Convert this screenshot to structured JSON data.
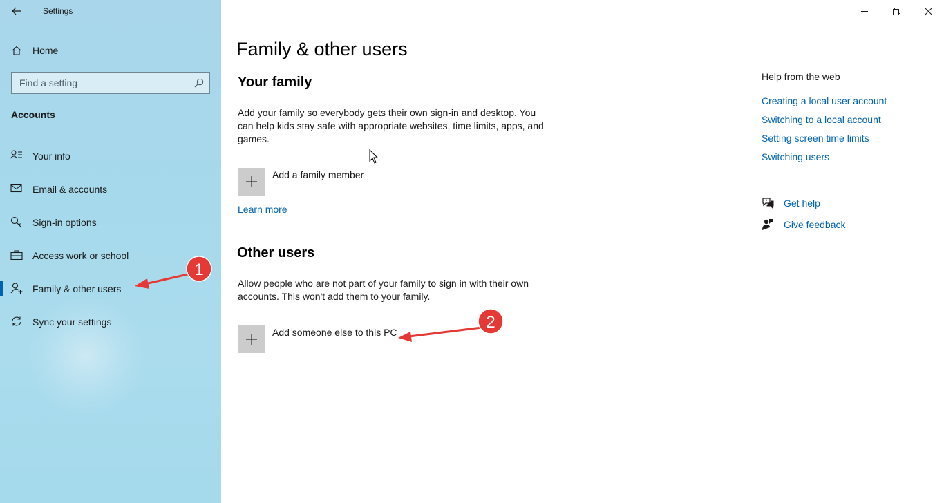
{
  "window": {
    "title": "Settings",
    "controls": [
      "minimize",
      "restore",
      "close"
    ]
  },
  "sidebar": {
    "home_label": "Home",
    "search_placeholder": "Find a setting",
    "section_label": "Accounts",
    "items": [
      {
        "label": "Your info",
        "icon": "person-list-icon",
        "active": false
      },
      {
        "label": "Email & accounts",
        "icon": "mail-icon",
        "active": false
      },
      {
        "label": "Sign-in options",
        "icon": "key-icon",
        "active": false
      },
      {
        "label": "Access work or school",
        "icon": "briefcase-icon",
        "active": false
      },
      {
        "label": "Family & other users",
        "icon": "person-add-icon",
        "active": true
      },
      {
        "label": "Sync your settings",
        "icon": "sync-icon",
        "active": false
      }
    ]
  },
  "main": {
    "title": "Family & other users",
    "family": {
      "heading": "Your family",
      "description": "Add your family so everybody gets their own sign-in and desktop. You can help kids stay safe with appropriate websites, time limits, apps, and games.",
      "add_label": "Add a family member",
      "learn_more": "Learn more"
    },
    "other_users": {
      "heading": "Other users",
      "description": "Allow people who are not part of your family to sign in with their own accounts. This won't add them to your family.",
      "add_label": "Add someone else to this PC"
    }
  },
  "help": {
    "heading": "Help from the web",
    "links": [
      "Creating a local user account",
      "Switching to a local account",
      "Setting screen time limits",
      "Switching users"
    ],
    "get_help": "Get help",
    "give_feedback": "Give feedback"
  },
  "annotations": {
    "marker_1": "1",
    "marker_2": "2",
    "color": "#e53935"
  },
  "colors": {
    "accent": "#0063b1",
    "sidebar_bg": "#a9d6eb",
    "tile_bg": "#cccccc"
  }
}
